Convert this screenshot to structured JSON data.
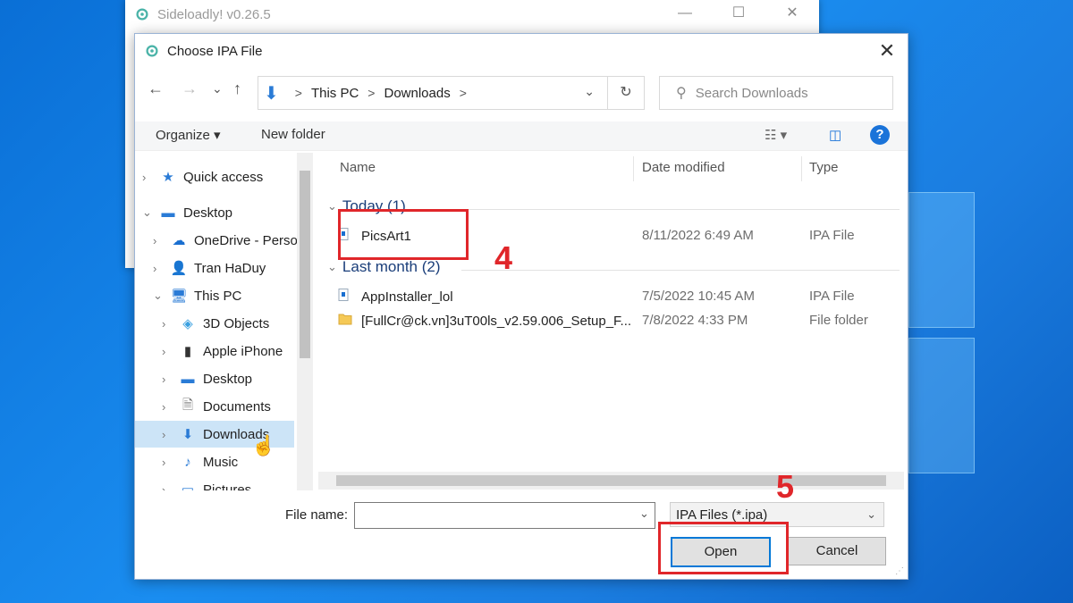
{
  "background_app": {
    "title": "Sideloadly! v0.26.5",
    "controls": [
      "—",
      "☐",
      "✕"
    ]
  },
  "dialog": {
    "title": "Choose IPA File",
    "close": "✕",
    "nav": {
      "back": "←",
      "forward": "→",
      "recent": "⌄",
      "up": "↑",
      "breadcrumb": [
        "This PC",
        "Downloads"
      ],
      "separator": ">",
      "refresh": "↻",
      "search_placeholder": "Search Downloads"
    },
    "toolbar": {
      "organize": "Organize ▾",
      "new_folder": "New folder",
      "help": "?"
    },
    "nav_pane": [
      {
        "label": "Quick access",
        "icon": "★"
      },
      {
        "label": "Desktop",
        "icon": "▬"
      },
      {
        "label": "OneDrive - Perso",
        "icon": "☁"
      },
      {
        "label": "Tran HaDuy",
        "icon": "👤"
      },
      {
        "label": "This PC",
        "icon": "🖥"
      },
      {
        "label": "3D Objects",
        "icon": "◈"
      },
      {
        "label": "Apple iPhone",
        "icon": "▮"
      },
      {
        "label": "Desktop",
        "icon": "▬"
      },
      {
        "label": "Documents",
        "icon": "🗎"
      },
      {
        "label": "Downloads",
        "icon": "⬇"
      },
      {
        "label": "Music",
        "icon": "♪"
      },
      {
        "label": "Pictures",
        "icon": "▭"
      }
    ],
    "columns": {
      "name": "Name",
      "date": "Date modified",
      "type": "Type"
    },
    "groups": [
      {
        "label": "Today (1)",
        "files": [
          {
            "name": "PicsArt1",
            "date": "8/11/2022 6:49 AM",
            "type": "IPA File"
          }
        ]
      },
      {
        "label": "Last month (2)",
        "files": [
          {
            "name": "AppInstaller_lol",
            "date": "7/5/2022 10:45 AM",
            "type": "IPA File"
          },
          {
            "name": "[FullCr@ck.vn]3uT00ls_v2.59.006_Setup_F...",
            "date": "7/8/2022 4:33 PM",
            "type": "File folder"
          }
        ]
      }
    ],
    "bottom": {
      "file_name_label": "File name:",
      "file_name_value": "",
      "filter": "IPA Files (*.ipa)",
      "open": "Open",
      "cancel": "Cancel"
    }
  },
  "annotations": {
    "step_select": "4",
    "step_open": "5"
  },
  "colors": {
    "accent": "#0078d7",
    "annotation": "#e0262a",
    "selected": "#cce4f7",
    "desktop": "#1a8df0"
  }
}
